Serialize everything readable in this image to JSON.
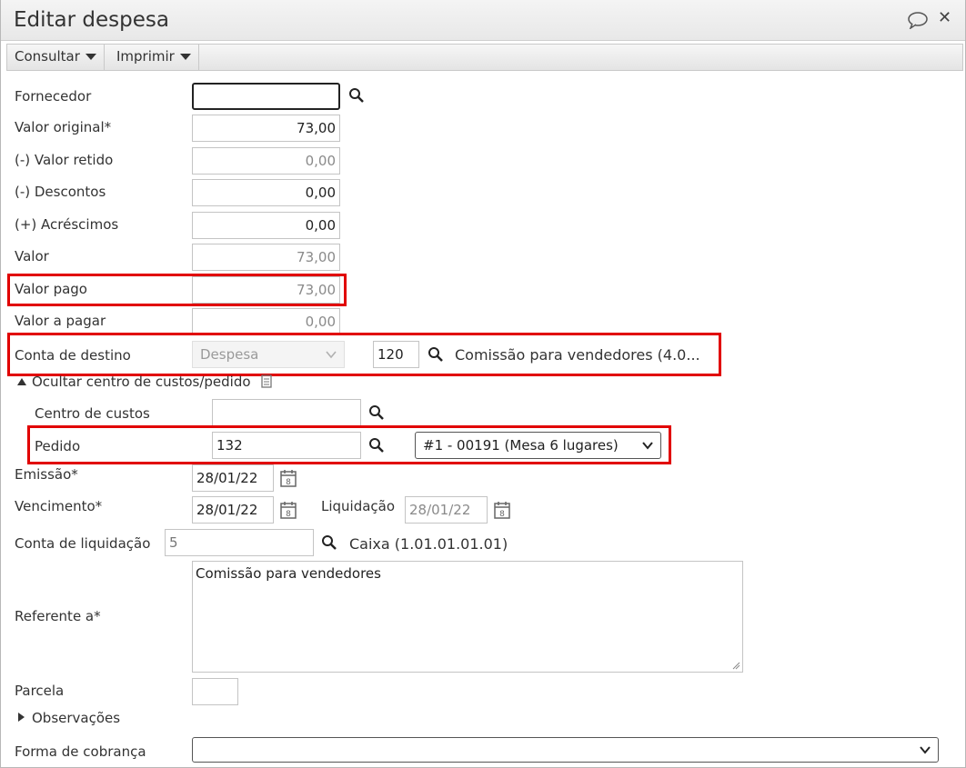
{
  "window": {
    "title": "Editar despesa"
  },
  "toolbar": {
    "consultar": "Consultar",
    "imprimir": "Imprimir"
  },
  "form": {
    "fornecedor": {
      "label": "Fornecedor",
      "value": ""
    },
    "valor_original": {
      "label": "Valor original*",
      "value": "73,00"
    },
    "valor_retido": {
      "label": "(-) Valor retido",
      "value": "0,00"
    },
    "descontos": {
      "label": "(-) Descontos",
      "value": "0,00"
    },
    "acrescimos": {
      "label": "(+) Acréscimos",
      "value": "0,00"
    },
    "valor": {
      "label": "Valor",
      "value": "73,00"
    },
    "valor_pago": {
      "label": "Valor pago",
      "value": "73,00"
    },
    "valor_a_pagar": {
      "label": "Valor a pagar",
      "value": "0,00"
    },
    "conta_destino": {
      "label": "Conta de destino",
      "type_selected": "Despesa",
      "code": "120",
      "description": "Comissão para vendedores (4.0..."
    },
    "centro_toggle": "Ocultar centro de custos/pedido",
    "centro_custos": {
      "label": "Centro de custos",
      "value": ""
    },
    "pedido": {
      "label": "Pedido",
      "value": "132",
      "selected": "#1 - 00191 (Mesa 6 lugares)"
    },
    "emissao": {
      "label": "Emissão*",
      "value": "28/01/22"
    },
    "vencimento": {
      "label": "Vencimento*",
      "value": "28/01/22"
    },
    "liquidacao": {
      "label": "Liquidação",
      "value": "28/01/22"
    },
    "conta_liquidacao": {
      "label": "Conta de liquidação",
      "value": "5",
      "description": "Caixa (1.01.01.01.01)"
    },
    "referente": {
      "label": "Referente a*",
      "value": "Comissão para vendedores"
    },
    "parcela": {
      "label": "Parcela",
      "value": ""
    },
    "observacoes_toggle": "Observações",
    "forma_cobranca": {
      "label": "Forma de cobrança",
      "selected": ""
    }
  },
  "colors": {
    "highlight": "#e10000"
  }
}
